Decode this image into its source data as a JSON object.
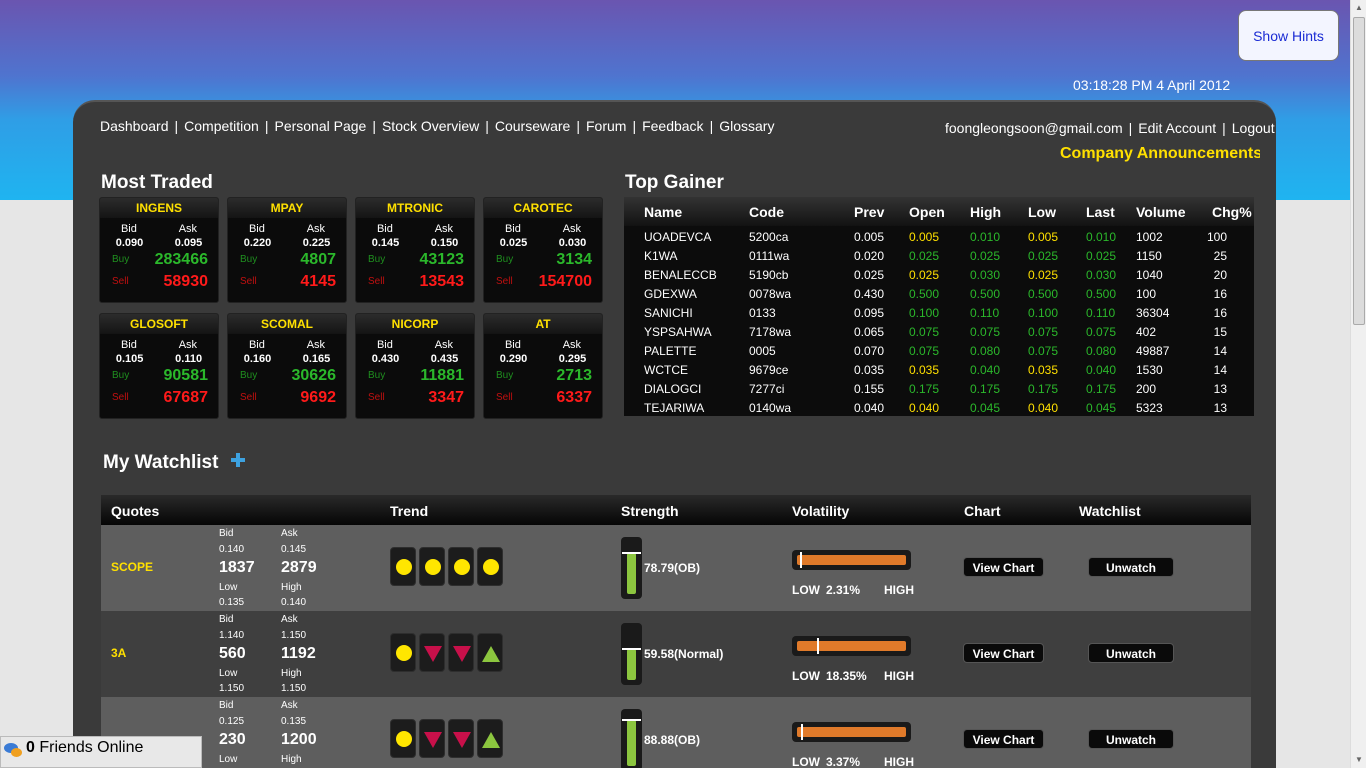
{
  "hint_button": "Show Hints",
  "clock": "03:18:28 PM 4 April 2012",
  "nav": [
    "Dashboard",
    "Competition",
    "Personal Page",
    "Stock Overview",
    "Courseware",
    "Forum",
    "Feedback",
    "Glossary"
  ],
  "account": {
    "email": "foongleongsoon@gmail.com",
    "edit": "Edit Account",
    "logout": "Logout"
  },
  "announcements": "Company Announcements",
  "most_traded": {
    "title": "Most Traded",
    "bid_label": "Bid",
    "ask_label": "Ask",
    "buy_label": "Buy",
    "sell_label": "Sell",
    "tiles": [
      {
        "name": "INGENS",
        "bid": "0.090",
        "ask": "0.095",
        "buy": "283466",
        "sell": "58930"
      },
      {
        "name": "MPAY",
        "bid": "0.220",
        "ask": "0.225",
        "buy": "4807",
        "sell": "4145"
      },
      {
        "name": "MTRONIC",
        "bid": "0.145",
        "ask": "0.150",
        "buy": "43123",
        "sell": "13543"
      },
      {
        "name": "CAROTEC",
        "bid": "0.025",
        "ask": "0.030",
        "buy": "3134",
        "sell": "154700"
      },
      {
        "name": "GLOSOFT",
        "bid": "0.105",
        "ask": "0.110",
        "buy": "90581",
        "sell": "67687"
      },
      {
        "name": "SCOMAL",
        "bid": "0.160",
        "ask": "0.165",
        "buy": "30626",
        "sell": "9692"
      },
      {
        "name": "NICORP",
        "bid": "0.430",
        "ask": "0.435",
        "buy": "11881",
        "sell": "3347"
      },
      {
        "name": "AT",
        "bid": "0.290",
        "ask": "0.295",
        "buy": "2713",
        "sell": "6337"
      }
    ]
  },
  "top_gainer": {
    "title": "Top Gainer",
    "headers": [
      "Name",
      "Code",
      "Prev",
      "Open",
      "High",
      "Low",
      "Last",
      "Volume",
      "Chg%"
    ],
    "rows": [
      {
        "name": "UOADEVCA",
        "code": "5200ca",
        "prev": "0.005",
        "open": "0.005",
        "high": "0.010",
        "low": "0.005",
        "last": "0.010",
        "volume": "1002",
        "chg": "100",
        "oc": "y",
        "hc": "g",
        "lc": "y",
        "lac": "g"
      },
      {
        "name": "K1WA",
        "code": "0111wa",
        "prev": "0.020",
        "open": "0.025",
        "high": "0.025",
        "low": "0.025",
        "last": "0.025",
        "volume": "1150",
        "chg": "25",
        "oc": "g",
        "hc": "g",
        "lc": "g",
        "lac": "g"
      },
      {
        "name": "BENALECCB",
        "code": "5190cb",
        "prev": "0.025",
        "open": "0.025",
        "high": "0.030",
        "low": "0.025",
        "last": "0.030",
        "volume": "1040",
        "chg": "20",
        "oc": "y",
        "hc": "g",
        "lc": "y",
        "lac": "g"
      },
      {
        "name": "GDEXWA",
        "code": "0078wa",
        "prev": "0.430",
        "open": "0.500",
        "high": "0.500",
        "low": "0.500",
        "last": "0.500",
        "volume": "100",
        "chg": "16",
        "oc": "g",
        "hc": "g",
        "lc": "g",
        "lac": "g"
      },
      {
        "name": "SANICHI",
        "code": "0133",
        "prev": "0.095",
        "open": "0.100",
        "high": "0.110",
        "low": "0.100",
        "last": "0.110",
        "volume": "36304",
        "chg": "16",
        "oc": "g",
        "hc": "g",
        "lc": "g",
        "lac": "g"
      },
      {
        "name": "YSPSAHWA",
        "code": "7178wa",
        "prev": "0.065",
        "open": "0.075",
        "high": "0.075",
        "low": "0.075",
        "last": "0.075",
        "volume": "402",
        "chg": "15",
        "oc": "g",
        "hc": "g",
        "lc": "g",
        "lac": "g"
      },
      {
        "name": "PALETTE",
        "code": "0005",
        "prev": "0.070",
        "open": "0.075",
        "high": "0.080",
        "low": "0.075",
        "last": "0.080",
        "volume": "49887",
        "chg": "14",
        "oc": "g",
        "hc": "g",
        "lc": "g",
        "lac": "g"
      },
      {
        "name": "WCTCE",
        "code": "9679ce",
        "prev": "0.035",
        "open": "0.035",
        "high": "0.040",
        "low": "0.035",
        "last": "0.040",
        "volume": "1530",
        "chg": "14",
        "oc": "y",
        "hc": "g",
        "lc": "y",
        "lac": "g"
      },
      {
        "name": "DIALOGCI",
        "code": "7277ci",
        "prev": "0.155",
        "open": "0.175",
        "high": "0.175",
        "low": "0.175",
        "last": "0.175",
        "volume": "200",
        "chg": "13",
        "oc": "g",
        "hc": "g",
        "lc": "g",
        "lac": "g"
      },
      {
        "name": "TEJARIWA",
        "code": "0140wa",
        "prev": "0.040",
        "open": "0.040",
        "high": "0.045",
        "low": "0.040",
        "last": "0.045",
        "volume": "5323",
        "chg": "13",
        "oc": "y",
        "hc": "g",
        "lc": "y",
        "lac": "g"
      }
    ]
  },
  "watchlist": {
    "title": "My Watchlist",
    "headers": [
      "Quotes",
      "Trend",
      "Strength",
      "Volatility",
      "Chart",
      "Watchlist"
    ],
    "labels": {
      "bid": "Bid",
      "ask": "Ask",
      "low": "Low",
      "high": "High",
      "vol_low": "LOW",
      "vol_high": "HIGH",
      "view_chart": "View Chart",
      "unwatch": "Unwatch"
    },
    "rows": [
      {
        "name": "SCOPE",
        "bid": "0.140",
        "ask": "0.145",
        "bid_vol": "1837",
        "ask_vol": "2879",
        "low": "0.135",
        "high": "0.140",
        "trend": [
          "dot",
          "dot",
          "dot",
          "dot"
        ],
        "strength": "78.79(OB)",
        "strength_level": 0.79,
        "volatility": "2.31%",
        "volatility_level": 0.0231
      },
      {
        "name": "3A",
        "bid": "1.140",
        "ask": "1.150",
        "bid_vol": "560",
        "ask_vol": "1192",
        "low": "1.150",
        "high": "1.150",
        "trend": [
          "dot",
          "down",
          "down",
          "up"
        ],
        "strength": "59.58(Normal)",
        "strength_level": 0.5958,
        "volatility": "18.35%",
        "volatility_level": 0.1835
      },
      {
        "name": "",
        "bid": "0.125",
        "ask": "0.135",
        "bid_vol": "230",
        "ask_vol": "1200",
        "low": "",
        "high": "",
        "trend": [
          "dot",
          "down",
          "down",
          "up"
        ],
        "strength": "88.88(OB)",
        "strength_level": 0.8888,
        "volatility": "3.37%",
        "volatility_level": 0.0337
      }
    ]
  },
  "friends": {
    "count": "0",
    "label": "Friends Online"
  }
}
